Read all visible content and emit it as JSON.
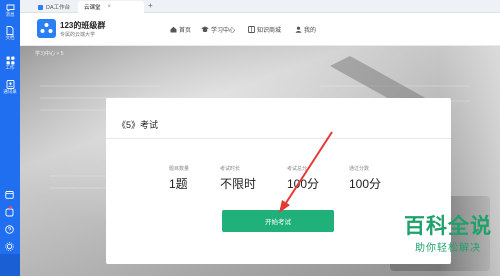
{
  "rail": {
    "items": [
      {
        "label": "消息",
        "icon": "chat-icon"
      },
      {
        "label": "文档",
        "icon": "document-icon"
      },
      {
        "label": "工作",
        "icon": "grid-icon"
      },
      {
        "label": "通讯录",
        "icon": "contacts-icon"
      }
    ],
    "bottom_icons": [
      "calendar-icon",
      "notification-icon",
      "help-icon",
      "settings-icon"
    ]
  },
  "tabs": [
    {
      "label": "DA工作台",
      "active": false
    },
    {
      "label": "云课堂",
      "active": true
    }
  ],
  "header": {
    "class_name": "123的班级群",
    "class_sub": "专属的云端大学",
    "nav": [
      {
        "label": "首页",
        "icon": "home-icon"
      },
      {
        "label": "学习中心",
        "icon": "graduation-icon"
      },
      {
        "label": "知识商城",
        "icon": "book-icon"
      },
      {
        "label": "我的",
        "icon": "user-icon"
      }
    ]
  },
  "breadcrumb": "学习中心 > 5",
  "exam": {
    "title": "《5》考试",
    "stats": [
      {
        "label": "题目数量",
        "value": "1题"
      },
      {
        "label": "考试时长",
        "value": "不限时"
      },
      {
        "label": "考试总分",
        "value": "100分"
      },
      {
        "label": "通过分数",
        "value": "100分"
      }
    ],
    "start_button": "开始考试"
  },
  "annotation": {
    "color": "#e53935"
  },
  "watermark": {
    "main": "百科全说",
    "sub": "助你轻松解决",
    "color": "#1fa16b"
  },
  "colors": {
    "rail": "#1f6ff0",
    "button": "#20b07a",
    "logo": "#2a7ff5"
  }
}
